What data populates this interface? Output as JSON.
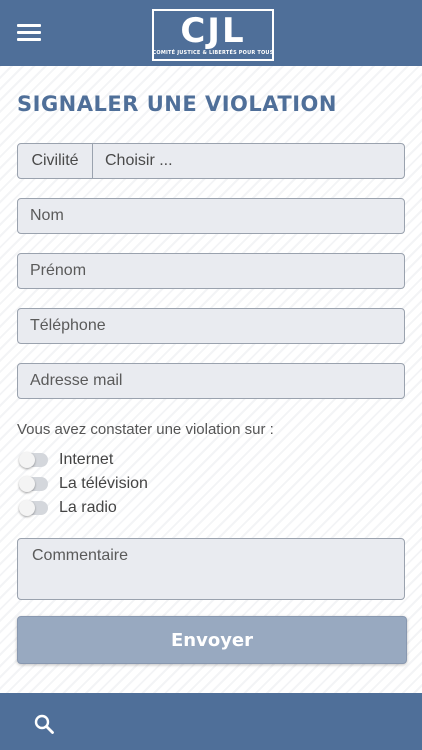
{
  "header": {
    "logo_text": "CJL",
    "logo_tagline": "COMITÉ JUSTICE & LIBERTÉS POUR TOUS",
    "menu_icon": "hamburger-icon"
  },
  "form": {
    "title": "SIGNALER UNE VIOLATION",
    "civilite": {
      "prefix": "Civilité",
      "value": "Choisir ..."
    },
    "nom_placeholder": "Nom",
    "prenom_placeholder": "Prénom",
    "telephone_placeholder": "Téléphone",
    "email_placeholder": "Adresse mail",
    "question": "Vous avez constater une violation sur :",
    "options": [
      {
        "label": "Internet",
        "checked": false
      },
      {
        "label": "La télévision",
        "checked": false
      },
      {
        "label": "La radio",
        "checked": false
      }
    ],
    "comment_placeholder": "Commentaire",
    "submit_label": "Envoyer"
  },
  "footer": {
    "search_icon": "search-icon"
  },
  "colors": {
    "primary": "#4f6f99",
    "button": "#98a9c0",
    "field_bg": "#e9ebf0",
    "field_border": "#9aa2ae"
  }
}
